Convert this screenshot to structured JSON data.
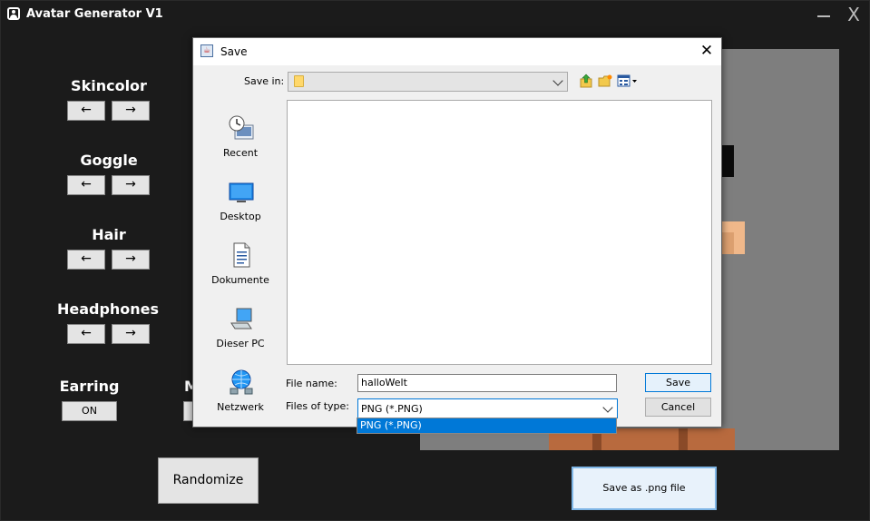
{
  "app": {
    "title": "Avatar Generator V1",
    "close_label": "X"
  },
  "controls": {
    "left_arrow": "←",
    "right_arrow": "→",
    "categories": [
      {
        "label": "Skincolor"
      },
      {
        "label": "Goggle"
      },
      {
        "label": "Hair"
      },
      {
        "label": "Headphones"
      }
    ],
    "earring_label": "Earring",
    "earring_value": "ON",
    "partial_label": "M",
    "randomize_label": "Randomize",
    "save_png_label": "Save as .png file"
  },
  "dialog": {
    "title": "Save",
    "save_in_label": "Save in:",
    "save_in_value": "",
    "places": [
      {
        "label": "Recent",
        "icon": "recent-icon"
      },
      {
        "label": "Desktop",
        "icon": "desktop-icon"
      },
      {
        "label": "Dokumente",
        "icon": "documents-icon"
      },
      {
        "label": "Dieser PC",
        "icon": "computer-icon"
      },
      {
        "label": "Netzwerk",
        "icon": "network-icon"
      }
    ],
    "file_name_label": "File name:",
    "file_name_value": "halloWelt",
    "files_of_type_label": "Files of type:",
    "files_of_type_value": "PNG (*.PNG)",
    "dropdown_options": [
      "PNG (*.PNG)"
    ],
    "save_button": "Save",
    "cancel_button": "Cancel"
  },
  "colors": {
    "app_background": "#1b1b1b",
    "preview_background": "#7e7e7e",
    "accent_blue": "#0078d7",
    "skin_light": "#f0b88a",
    "skin_dark": "#b86a3e"
  }
}
